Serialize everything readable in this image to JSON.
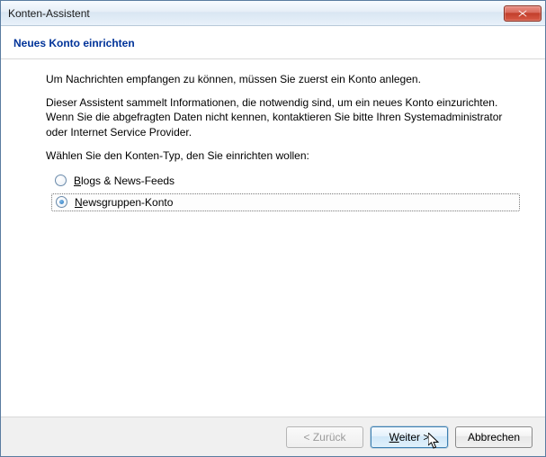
{
  "window": {
    "title": "Konten-Assistent"
  },
  "header": {
    "heading": "Neues Konto einrichten"
  },
  "body": {
    "intro": "Um Nachrichten empfangen zu können, müssen Sie zuerst ein Konto anlegen.",
    "desc": "Dieser Assistent sammelt Informationen, die notwendig sind, um ein neues Konto einzurichten. Wenn Sie die abgefragten Daten nicht kennen, kontaktieren Sie bitte Ihren Systemadministrator oder Internet Service Provider.",
    "prompt": "Wählen Sie den Konten-Typ, den Sie einrichten wollen:"
  },
  "options": [
    {
      "label_pre": "",
      "label_ul": "B",
      "label_post": "logs & News-Feeds",
      "selected": false
    },
    {
      "label_pre": "",
      "label_ul": "N",
      "label_post": "ewsgruppen-Konto",
      "selected": true
    }
  ],
  "buttons": {
    "back": "< Zurück",
    "next_ul": "W",
    "next_post": "eiter >",
    "cancel": "Abbrechen"
  }
}
